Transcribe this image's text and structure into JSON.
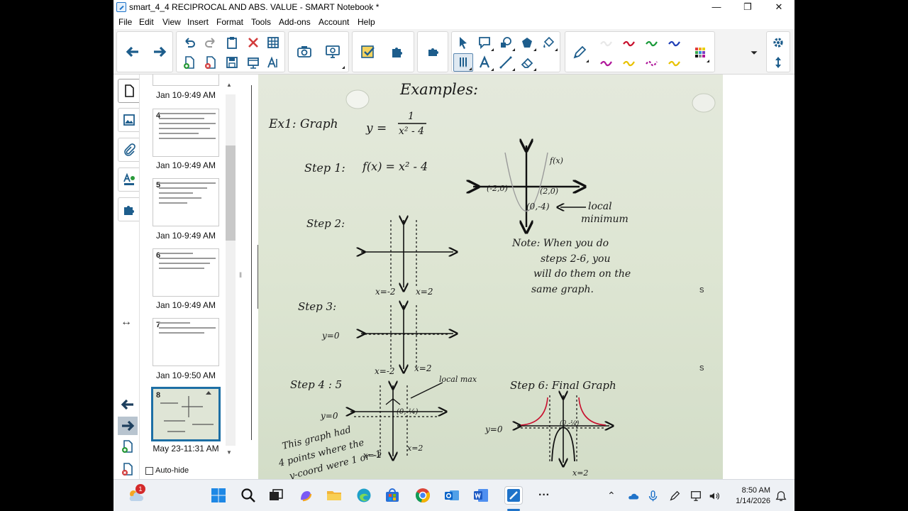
{
  "window": {
    "title": "smart_4_4 RECIPROCAL AND ABS. VALUE - SMART Notebook *",
    "minimize": "—",
    "maximize": "❐",
    "close": "✕"
  },
  "menu": [
    "File",
    "Edit",
    "View",
    "Insert",
    "Format",
    "Tools",
    "Add-ons",
    "Account",
    "Help"
  ],
  "colors": {
    "accent": "#1d5d8c",
    "pen_red": "#c8102e",
    "pen_green": "#1a9a3a",
    "pen_blue": "#1f3fb8",
    "pen_magenta": "#b0179a",
    "pen_yellow": "#e8c200"
  },
  "sorter": {
    "pages": [
      {
        "num": "",
        "label": "Jan 10-9:49 AM"
      },
      {
        "num": "4",
        "label": "Jan 10-9:49 AM"
      },
      {
        "num": "5",
        "label": "Jan 10-9:49 AM"
      },
      {
        "num": "6",
        "label": "Jan 10-9:49 AM"
      },
      {
        "num": "7",
        "label": "Jan 10-9:50 AM"
      },
      {
        "num": "8",
        "label": "May 23-11:31 AM"
      }
    ],
    "autohide": "Auto-hide"
  },
  "notes": {
    "heading": "Examples:",
    "ex1": "Ex1: Graph",
    "equation_y": "y =",
    "equation_num": "1",
    "equation_den": "x² - 4",
    "step1": "Step 1:",
    "step1_fx": "f(x) = x² - 4",
    "step2": "Step 2:",
    "step3": "Step 3:",
    "step45": "Step 4 : 5",
    "step6": "Step 6: Final Graph",
    "fx_label": "f(x)",
    "neg2_label": "(-2,0)",
    "pos2_label": "(2,0)",
    "vertex_label": "(0,-4)",
    "local_min": "local",
    "local_min2": "minimum",
    "note_line1": "Note: When you do",
    "note_line2": "steps 2-6, you",
    "note_line3": "will do them on the",
    "note_line4": "same graph.",
    "xneg2": "x=-2",
    "xpos2": "x=2",
    "y0": "y=0",
    "local_max": "local max",
    "side_note1": "This graph had",
    "side_note2": "4 points where the",
    "side_note3": "y-coord were 1 or -1",
    "half_label": "(0,-¼)"
  },
  "taskbar": {
    "notification_badge": "1",
    "more": "···",
    "time": "8:50 AM",
    "date": "1/14/2026"
  }
}
